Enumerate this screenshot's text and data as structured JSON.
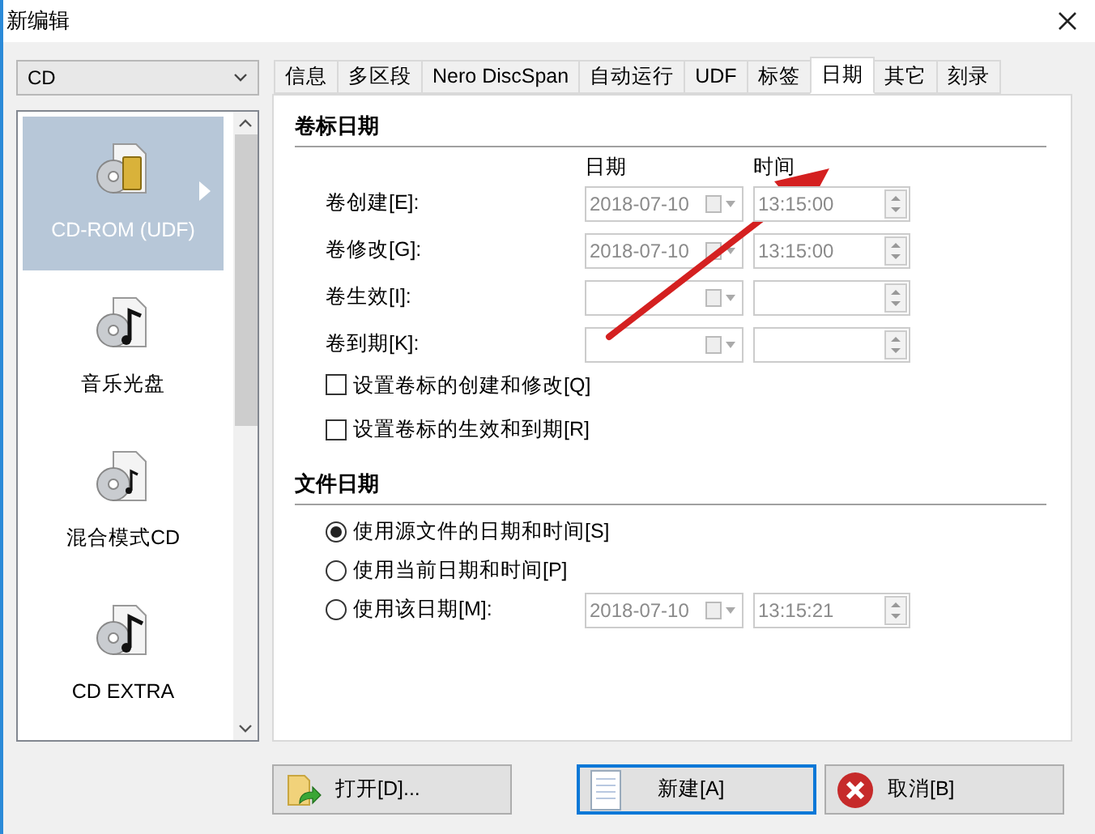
{
  "window": {
    "title": "新编辑"
  },
  "disc_type_dropdown": {
    "value": "CD"
  },
  "sidebar": {
    "items": [
      {
        "label": "CD-ROM (UDF)",
        "selected": true,
        "kind": "data"
      },
      {
        "label": "音乐光盘",
        "selected": false,
        "kind": "music"
      },
      {
        "label": "混合模式CD",
        "selected": false,
        "kind": "mixed"
      },
      {
        "label": "CD EXTRA",
        "selected": false,
        "kind": "extra"
      }
    ]
  },
  "tabs": [
    {
      "label": "信息",
      "selected": false
    },
    {
      "label": "多区段",
      "selected": false
    },
    {
      "label": "Nero DiscSpan",
      "selected": false
    },
    {
      "label": "自动运行",
      "selected": false
    },
    {
      "label": "UDF",
      "selected": false
    },
    {
      "label": "标签",
      "selected": false
    },
    {
      "label": "日期",
      "selected": true
    },
    {
      "label": "其它",
      "selected": false
    },
    {
      "label": "刻录",
      "selected": false
    }
  ],
  "volume_dates": {
    "heading": "卷标日期",
    "column_headers": [
      "日期",
      "时间"
    ],
    "rows": [
      {
        "label": "卷创建[E]:",
        "date": "2018-07-10",
        "time": "13:15:00",
        "disabled": true
      },
      {
        "label": "卷修改[G]:",
        "date": "2018-07-10",
        "time": "13:15:00",
        "disabled": true
      },
      {
        "label": "卷生效[I]:",
        "disabled": true
      },
      {
        "label": "卷到期[K]:",
        "disabled": true
      }
    ],
    "checkboxes": [
      {
        "label": "设置卷标的创建和修改[Q]",
        "checked": false
      },
      {
        "label": "设置卷标的生效和到期[R]",
        "checked": false
      }
    ]
  },
  "file_dates": {
    "heading": "文件日期",
    "options": [
      {
        "label": "使用源文件的日期和时间[S]",
        "selected": true
      },
      {
        "label": "使用当前日期和时间[P]",
        "selected": false
      },
      {
        "label": "使用该日期[M]:",
        "selected": false,
        "date": "2018-07-10",
        "time": "13:15:21",
        "disabled": true
      }
    ]
  },
  "buttons": [
    {
      "label": "打开[D]...",
      "kind": "open",
      "default": false
    },
    {
      "label": "新建[A]",
      "kind": "new",
      "default": true
    },
    {
      "label": "取消[B]",
      "kind": "cancel",
      "default": false
    }
  ]
}
